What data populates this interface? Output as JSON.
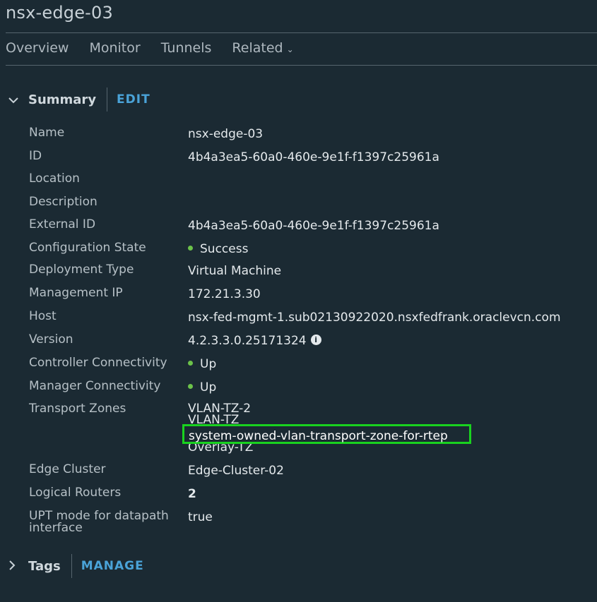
{
  "header": {
    "title": "nsx-edge-03"
  },
  "tabs": [
    {
      "label": "Overview"
    },
    {
      "label": "Monitor"
    },
    {
      "label": "Tunnels"
    },
    {
      "label": "Related"
    }
  ],
  "summary": {
    "label": "Summary",
    "action": "EDIT",
    "fields": {
      "name": {
        "key": "Name",
        "value": "nsx-edge-03"
      },
      "id": {
        "key": "ID",
        "value": "4b4a3ea5-60a0-460e-9e1f-f1397c25961a"
      },
      "location": {
        "key": "Location",
        "value": ""
      },
      "description": {
        "key": "Description",
        "value": ""
      },
      "external_id": {
        "key": "External ID",
        "value": "4b4a3ea5-60a0-460e-9e1f-f1397c25961a"
      },
      "configuration_state": {
        "key": "Configuration State",
        "value": "Success"
      },
      "deployment_type": {
        "key": "Deployment Type",
        "value": "Virtual Machine"
      },
      "management_ip": {
        "key": "Management IP",
        "value": "172.21.3.30"
      },
      "host": {
        "key": "Host",
        "value": "nsx-fed-mgmt-1.sub02130922020.nsxfedfrank.oraclevcn.com"
      },
      "version": {
        "key": "Version",
        "value": "4.2.3.3.0.25171324"
      },
      "controller_connectivity": {
        "key": "Controller Connectivity",
        "value": "Up"
      },
      "manager_connectivity": {
        "key": "Manager Connectivity",
        "value": "Up"
      },
      "transport_zones": {
        "key": "Transport Zones",
        "values": [
          "VLAN-TZ-2",
          "VLAN-TZ",
          "system-owned-vlan-transport-zone-for-rtep",
          "Overlay-TZ"
        ]
      },
      "edge_cluster": {
        "key": "Edge Cluster",
        "value": "Edge-Cluster-02"
      },
      "logical_routers": {
        "key": "Logical Routers",
        "value": "2"
      },
      "upt_mode": {
        "key_line1": "UPT mode for datapath",
        "key_line2": "interface",
        "value": "true"
      }
    }
  },
  "tags": {
    "label": "Tags",
    "action": "MANAGE"
  },
  "colors": {
    "background": "#1b2a33",
    "accent_link": "#4aa3d8",
    "status_green": "#6cc24a",
    "highlight_box": "#19d21f"
  },
  "icons": {
    "summary_toggle": "chevron-down-icon",
    "tags_toggle": "chevron-right-icon",
    "related_menu": "chevron-down-icon",
    "version_info": "info-icon"
  }
}
